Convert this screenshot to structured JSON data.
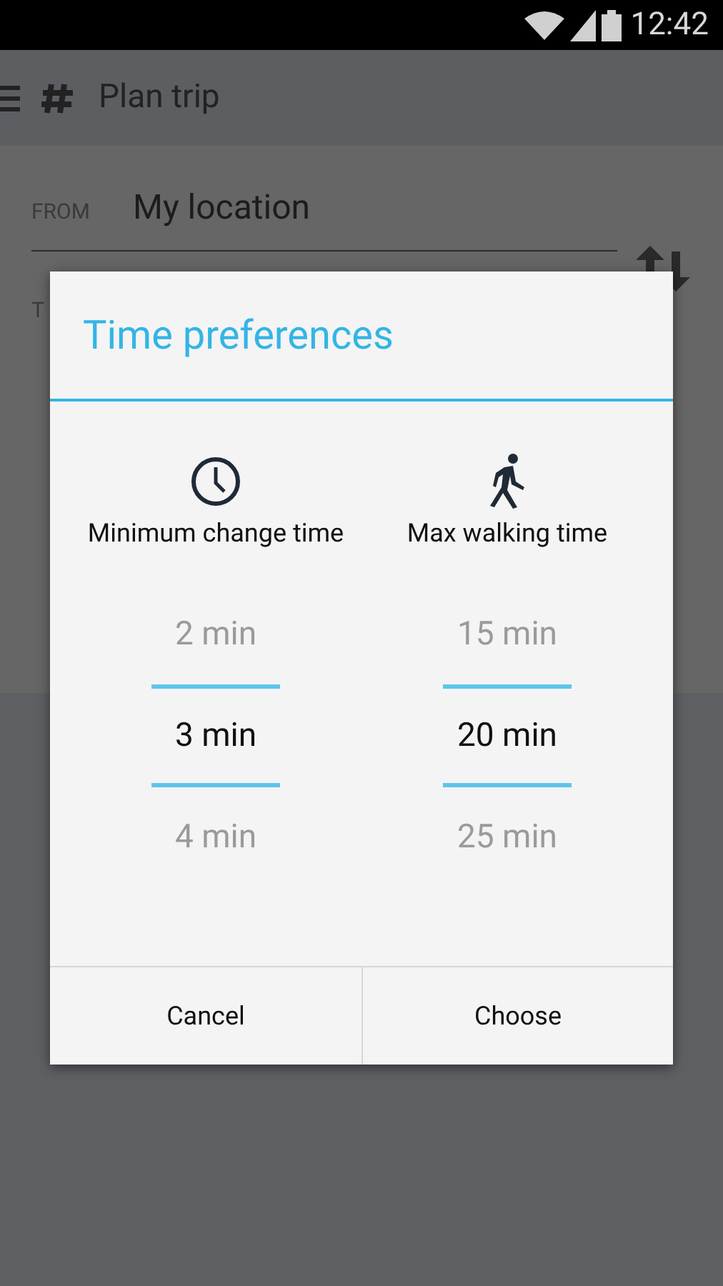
{
  "status_bar": {
    "time": "12:42"
  },
  "app_bar": {
    "title": "Plan trip"
  },
  "form": {
    "from_label": "FROM",
    "from_value": "My location",
    "to_label": "T"
  },
  "dialog": {
    "title": "Time preferences",
    "columns": [
      {
        "kind": "clock",
        "label": "Minimum change time",
        "options": [
          {
            "text": "2 min",
            "selected": false
          },
          {
            "text": "3 min",
            "selected": true
          },
          {
            "text": "4 min",
            "selected": false
          }
        ]
      },
      {
        "kind": "walk",
        "label": "Max walking time",
        "options": [
          {
            "text": "15 min",
            "selected": false
          },
          {
            "text": "20 min",
            "selected": true
          },
          {
            "text": "25 min",
            "selected": false
          }
        ]
      }
    ],
    "buttons": [
      "Cancel",
      "Choose"
    ]
  }
}
